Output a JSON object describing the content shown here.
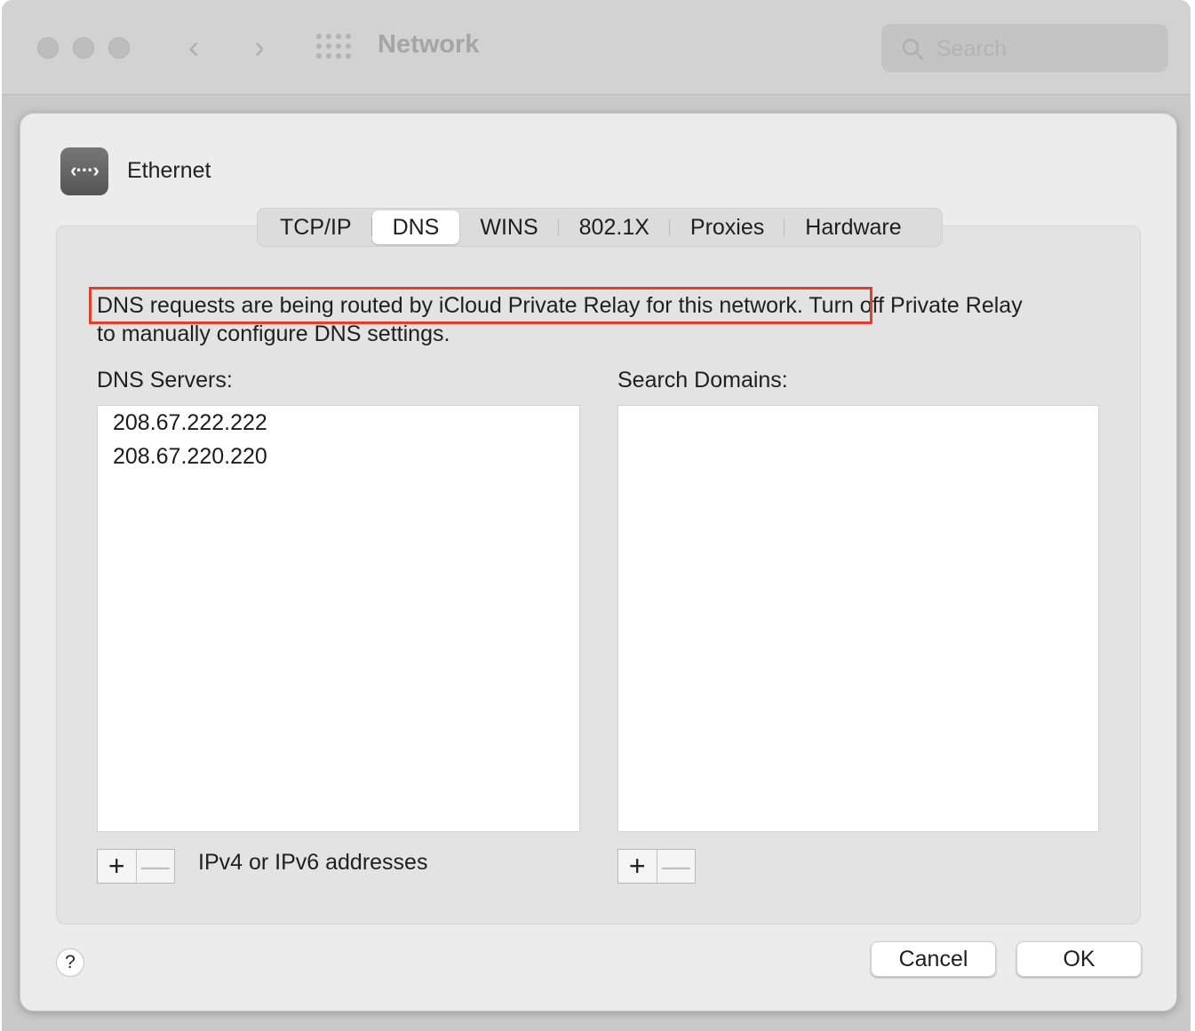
{
  "window": {
    "title": "Network",
    "search_placeholder": "Search"
  },
  "header": {
    "interface_name": "Ethernet",
    "icon": "ethernet-icon"
  },
  "tabs": [
    {
      "label": "TCP/IP",
      "active": false
    },
    {
      "label": "DNS",
      "active": true
    },
    {
      "label": "WINS",
      "active": false
    },
    {
      "label": "802.1X",
      "active": false
    },
    {
      "label": "Proxies",
      "active": false
    },
    {
      "label": "Hardware",
      "active": false
    }
  ],
  "notice": {
    "line1": "DNS requests are being routed by iCloud Private Relay for this network. Turn off Private Relay",
    "line2": "to manually configure DNS settings."
  },
  "dns_servers": {
    "label": "DNS Servers:",
    "items": [
      "208.67.222.222",
      "208.67.220.220"
    ],
    "hint": "IPv4 or IPv6 addresses"
  },
  "search_domains": {
    "label": "Search Domains:",
    "items": []
  },
  "controls": {
    "add_symbol": "+",
    "remove_symbol": "—"
  },
  "footer": {
    "help_label": "?",
    "cancel_label": "Cancel",
    "ok_label": "OK"
  },
  "colors": {
    "highlight_box": "#e0412b",
    "window_background": "#ececec"
  }
}
